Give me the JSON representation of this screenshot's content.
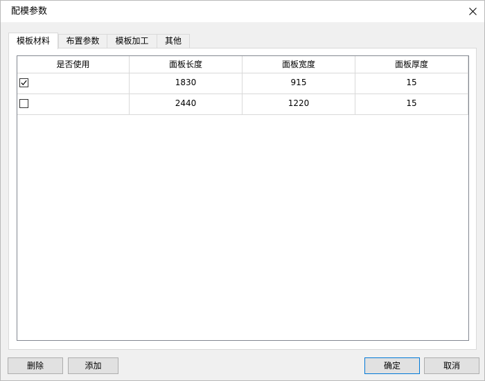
{
  "window": {
    "title": "配模参数"
  },
  "tabs": [
    {
      "label": "模板材料",
      "active": true
    },
    {
      "label": "布置参数",
      "active": false
    },
    {
      "label": "模板加工",
      "active": false
    },
    {
      "label": "其他",
      "active": false
    }
  ],
  "grid": {
    "columns": [
      "是否使用",
      "面板长度",
      "面板宽度",
      "面板厚度"
    ],
    "rows": [
      {
        "checked": true,
        "length": "1830",
        "width": "915",
        "thickness": "15"
      },
      {
        "checked": false,
        "length": "2440",
        "width": "1220",
        "thickness": "15"
      }
    ]
  },
  "buttons": {
    "delete_label": "删除",
    "add_label": "添加",
    "ok_label": "确定",
    "cancel_label": "取消"
  },
  "colors": {
    "accent": "#0078d7",
    "border": "#828790",
    "grid_line": "#d9d9d9",
    "button_bg": "#e1e1e1"
  }
}
